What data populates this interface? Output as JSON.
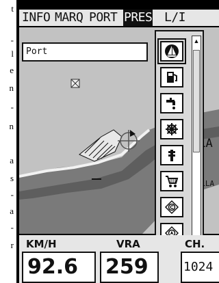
{
  "left_margin": {
    "fragments": [
      "t",
      "-",
      "l",
      "e",
      "n",
      "-",
      "n",
      "a",
      "s",
      "-",
      "a",
      "-",
      "r"
    ]
  },
  "menu": {
    "tabs": [
      {
        "label": "INFO",
        "active": false
      },
      {
        "label": "MARQ",
        "active": false
      },
      {
        "label": "PORT",
        "active": false
      },
      {
        "label": "PRES",
        "active": true
      },
      {
        "label": "L/I",
        "active": false
      }
    ]
  },
  "search": {
    "value": "Port"
  },
  "chart": {
    "labels": [
      "LLA",
      "RELLA"
    ],
    "colors": {
      "land": "#c2c2c2",
      "water": "#7a7a7a",
      "deep": "#5e5e5e",
      "shore": "#f2f2f2"
    }
  },
  "palette": {
    "selected_index": 0,
    "items": [
      {
        "icon": "sailboat-icon"
      },
      {
        "icon": "fuel-pump-icon"
      },
      {
        "icon": "water-tap-icon"
      },
      {
        "icon": "ship-wheel-icon"
      },
      {
        "icon": "crane-hoist-icon"
      },
      {
        "icon": "shopping-cart-icon"
      },
      {
        "icon": "copyright-diamond-icon"
      },
      {
        "icon": "navigation-diamond-icon"
      }
    ],
    "scroll_up": "▲",
    "scroll_down": "▼"
  },
  "status": {
    "speed_label": "KM/H",
    "speed_value": "92.6",
    "heading_label": "VRA",
    "heading_value": "259",
    "third_label": "CH.",
    "third_value": "1024"
  }
}
